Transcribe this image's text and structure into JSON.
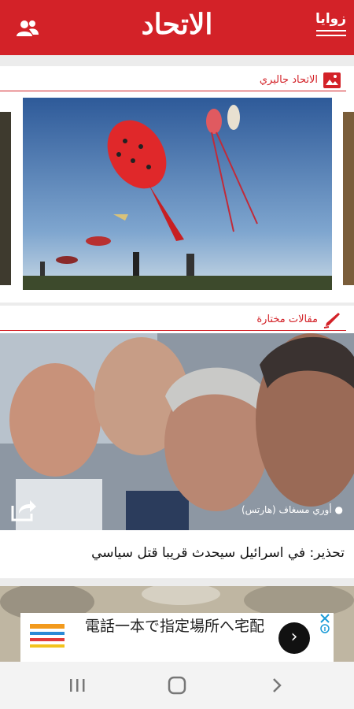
{
  "header": {
    "app_logo_text": "الاتحاد",
    "menu_label": "زوايا"
  },
  "gallery": {
    "section_title": "الاتحاد جاليري"
  },
  "featured": {
    "section_title": "مقالات مختارة",
    "article": {
      "photo_credit": "أوري مسغاف (هارتس)",
      "title": "تحذير: في اسرائيل سيحدث قريبا قتل سياسي"
    }
  },
  "ad": {
    "text": "電話一本で指定場所へ宅配",
    "go_icon": "chevron-right-icon",
    "info_icon": "info-icon"
  },
  "colors": {
    "brand": "#d32228"
  }
}
